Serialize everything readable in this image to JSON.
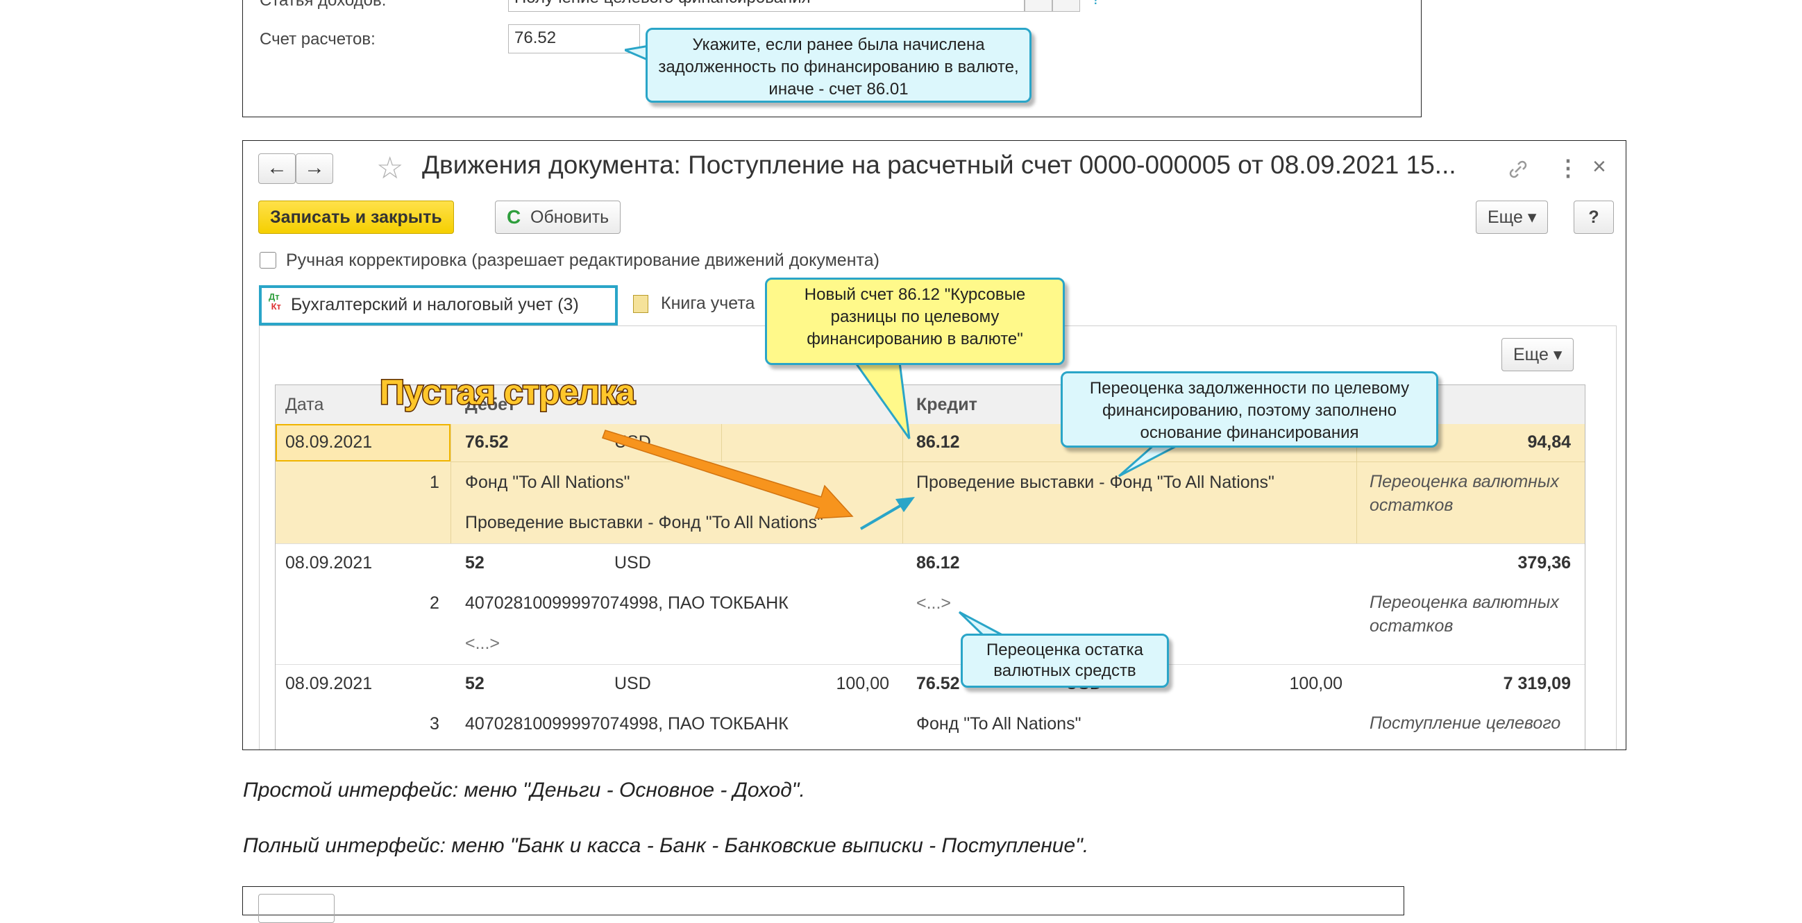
{
  "top_form": {
    "income_label": "Статья доходов:",
    "income_value": "Получение целевого финансирования",
    "account_label": "Счет расчетов:",
    "account_value": "76.52",
    "callout": "Укажите, если ранее была начислена задолженность по финансированию в валюте, иначе - счет 86.01"
  },
  "window": {
    "back_label": "←",
    "forward_label": "→",
    "star_label": "☆",
    "title": "Движения документа: Поступление на расчетный счет 0000-000005 от 08.09.2021 15...",
    "link_icon": "🔗",
    "more_icon": "⋮",
    "close_icon": "×",
    "save_close_label": "Записать и закрыть",
    "refresh_icon": "C",
    "refresh_label": "Обновить",
    "more_label": "Еще ▾",
    "help_label": "?",
    "manual_edit_label": "Ручная корректировка (разрешает редактирование движений документа)",
    "tab_accounting_label": "Бухгалтерский и налоговый учет (3)",
    "tab_accounting_icon": "ДтКт",
    "tab_book_label": "Книга учета",
    "panel_more_label": "Еще ▾"
  },
  "table": {
    "headers": {
      "date": "Дата",
      "debit": "Дебет",
      "credit": "Кредит"
    },
    "rows": [
      {
        "date": "08.09.2021",
        "num": "1",
        "debit_account": "76.52",
        "debit_currency": "USD",
        "debit_amount": "",
        "debit_sub1": "Фонд \"To All Nations\"",
        "debit_sub2": "Проведение выставки - Фонд \"To All Nations\"",
        "credit_account": "86.12",
        "credit_currency": "",
        "credit_amount": "",
        "credit_sub1": "Проведение выставки - Фонд \"To All Nations\"",
        "sum": "94,84",
        "content": "Переоценка валютных остатков"
      },
      {
        "date": "08.09.2021",
        "num": "2",
        "debit_account": "52",
        "debit_currency": "USD",
        "debit_amount": "",
        "debit_sub1": "40702810099997074998, ПАО ТОКБАНК",
        "debit_sub2": "<...>",
        "credit_account": "86.12",
        "credit_currency": "",
        "credit_amount": "",
        "credit_sub1": "<...>",
        "sum": "379,36",
        "content": "Переоценка валютных остатков"
      },
      {
        "date": "08.09.2021",
        "num": "3",
        "debit_account": "52",
        "debit_currency": "USD",
        "debit_amount": "100,00",
        "debit_sub1": "40702810099997074998, ПАО ТОКБАНК",
        "credit_account": "76.52",
        "credit_currency": "USD",
        "credit_amount": "100,00",
        "credit_sub1": "Фонд \"To All Nations\"",
        "sum": "7 319,09",
        "content": "Поступление целевого"
      }
    ]
  },
  "callouts": {
    "new_account": "Новый счет 86.12 \"Курсовые разницы по целевому финансированию в валюте\"",
    "revaluation_debt": "Переоценка задолженности по целевому финансированию, поэтому заполнено основание финансирования",
    "revaluation_cash": "Переоценка остатка валютных средств",
    "empty_arrow": "Пустая стрелка"
  },
  "captions": {
    "simple": "Простой интерфейс: меню \"Деньги - Основное - Доход\".",
    "full": "Полный интерфейс: меню \"Банк и касса - Банк - Банковские выписки - Поступление\"."
  },
  "colors": {
    "accent": "#2aa5c8",
    "primary_button": "#f5cf00",
    "selected_row": "#fbecc0",
    "arrow": "#f7941d"
  }
}
